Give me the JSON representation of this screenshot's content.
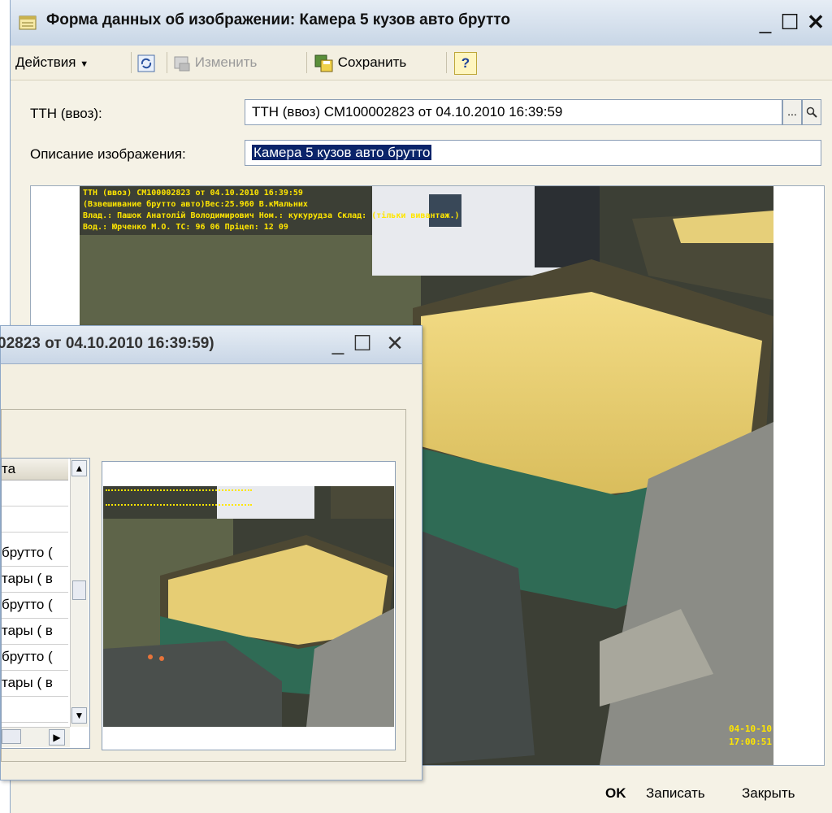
{
  "main_window": {
    "title": "Форма данных об изображении: Камера 5 кузов авто брутто",
    "minimize": "_",
    "maximize": "☐",
    "close": "✕"
  },
  "toolbar": {
    "actions_label": "Действия",
    "edit_label": "Изменить",
    "save_label": "Сохранить",
    "help_label": "?"
  },
  "form": {
    "ttn_label": "ТТН (ввоз):",
    "ttn_value": "ТТН (ввоз) СМ100002823 от 04.10.2010 16:39:59",
    "ttn_select_btn": "...",
    "description_label": "Описание изображения:",
    "description_value": "Камера 5 кузов авто брутто"
  },
  "photo_overlay": {
    "line1": "ТТН (ввоз) СМ100002823 от 04.10.2010 16:39:59",
    "line2": "(Взвешивание брутто авто)Вес:25.960 В.кМальних",
    "line3": "Влад.: Пашок Анатолій Володимирович  Ном.: кукурудза Склад: (тільки вивантаж.)",
    "line4": "Вод.: Юрченко М.О.  ТС: 96 06 Пріцеп: 12 09",
    "date": "04-10-10",
    "time": "17:00:51"
  },
  "footer": {
    "ok_label": "OK",
    "write_label": "Записать",
    "close_label": "Закрыть"
  },
  "second_window": {
    "title": "02823 от 04.10.2010 16:39:59)",
    "minimize": "_",
    "maximize": "☐",
    "close": "✕",
    "grid_header": "та",
    "rows": [
      "",
      "",
      "брутто (",
      "тары ( в",
      "брутто (",
      "тары ( в",
      "брутто (",
      "тары ( в",
      ""
    ]
  }
}
